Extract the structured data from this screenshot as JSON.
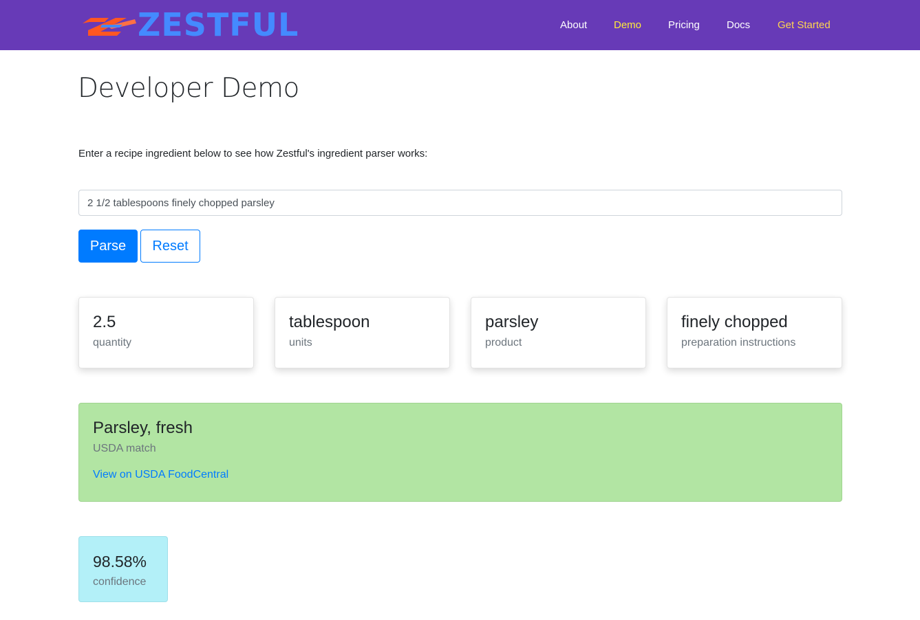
{
  "brand": {
    "name": "ZESTFUL",
    "logo_icon": "zest-swoosh-logo",
    "colors": {
      "text": "#448aff",
      "swoosh": "#ff5722"
    }
  },
  "nav": {
    "background": "#673ab7",
    "items": [
      {
        "label": "About"
      },
      {
        "label": "Demo",
        "active": true
      },
      {
        "label": "Pricing"
      },
      {
        "label": "Docs"
      },
      {
        "label": "Get Started"
      }
    ]
  },
  "main": {
    "title": "Developer Demo",
    "intro": "Enter a recipe ingredient below to see how Zestful's ingredient parser works:",
    "input": {
      "value": "2 1/2 tablespoons finely chopped parsley"
    },
    "buttons": {
      "parse": "Parse",
      "reset": "Reset"
    },
    "results": [
      {
        "value": "2.5",
        "label": "quantity"
      },
      {
        "value": "tablespoon",
        "label": "units"
      },
      {
        "value": "parsley",
        "label": "product"
      },
      {
        "value": "finely chopped",
        "label": "preparation instructions"
      }
    ],
    "usda": {
      "name": "Parsley, fresh",
      "label": "USDA match",
      "link": "View on USDA FoodCentral",
      "color": "#b2e5a3"
    },
    "confidence": {
      "value": "98.58%",
      "label": "confidence",
      "color": "#b3f0f8"
    }
  }
}
